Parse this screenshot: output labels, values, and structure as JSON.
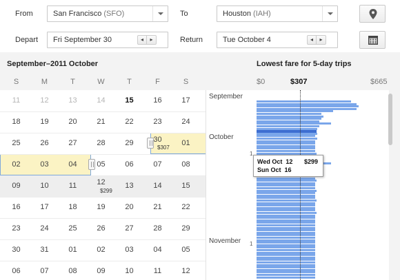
{
  "search": {
    "from_label": "From",
    "from_city": "San Francisco",
    "from_code": "(SFO)",
    "to_label": "To",
    "to_city": "Houston",
    "to_code": "(IAH)",
    "depart_label": "Depart",
    "depart_value": "Fri September 30",
    "return_label": "Return",
    "return_value": "Tue October 4",
    "stepper_prev": "◂",
    "stepper_next": "▸",
    "map_icon": "map-pin-icon",
    "calendar_icon": "calendar-icon"
  },
  "calendar": {
    "title": "September–2011 October",
    "weekdays": [
      "S",
      "M",
      "T",
      "W",
      "T",
      "F",
      "S"
    ],
    "weeks": [
      [
        "11",
        "12",
        "13",
        "14",
        "15",
        "16",
        "17"
      ],
      [
        "18",
        "19",
        "20",
        "21",
        "22",
        "23",
        "24"
      ],
      [
        "25",
        "26",
        "27",
        "28",
        "29",
        "30",
        "01"
      ],
      [
        "02",
        "03",
        "04",
        "05",
        "06",
        "07",
        "08"
      ],
      [
        "09",
        "10",
        "11",
        "12",
        "13",
        "14",
        "15"
      ],
      [
        "16",
        "17",
        "18",
        "19",
        "20",
        "21",
        "22"
      ],
      [
        "23",
        "24",
        "25",
        "26",
        "27",
        "28",
        "29"
      ],
      [
        "30",
        "31",
        "01",
        "02",
        "03",
        "04",
        "05"
      ],
      [
        "06",
        "07",
        "08",
        "09",
        "10",
        "11",
        "12"
      ]
    ],
    "price_return": "$307",
    "price_oct12": "$299"
  },
  "months": {
    "september": "September",
    "october": "October",
    "november": "November",
    "tick_one": "1"
  },
  "chart": {
    "title": "Lowest fare for 5-day trips",
    "axis_min": "$0",
    "axis_current": "$307",
    "axis_max": "$665",
    "bar_color": "#7aa6ea",
    "selected_color": "#3d6ed1",
    "tooltip": {
      "line1_day": "Wed Oct",
      "line1_date": "12",
      "line2_day": "Sun Oct",
      "line2_date": "16",
      "price": "$299"
    }
  },
  "chart_data": {
    "type": "bar",
    "orientation": "horizontal",
    "title": "Lowest fare for 5-day trips",
    "xlim": [
      0,
      665
    ],
    "reference_value": 307,
    "values": [
      480,
      510,
      520,
      510,
      390,
      330,
      340,
      330,
      320,
      380,
      320,
      310,
      307,
      310,
      299,
      310,
      300,
      300,
      300,
      300,
      300,
      305,
      305,
      310,
      300,
      380,
      305,
      310,
      300,
      300,
      305,
      300,
      305,
      300,
      300,
      300,
      305,
      300,
      300,
      300,
      305,
      300,
      300,
      300,
      300,
      305,
      300,
      300,
      300,
      300,
      300,
      300,
      300,
      300,
      300,
      300,
      300,
      300,
      300,
      300,
      300,
      300,
      300,
      300,
      300,
      300,
      300,
      300,
      300,
      300,
      300,
      300
    ]
  }
}
